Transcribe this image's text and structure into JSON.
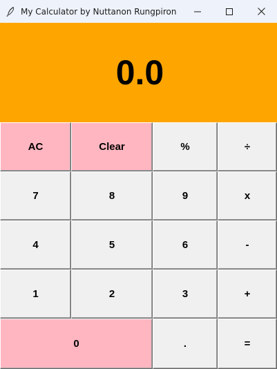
{
  "window": {
    "title": "My Calculator by Nuttanon Rungpiron",
    "minimize_glyph": "—",
    "maximize_glyph": "☐",
    "close_glyph": "✕"
  },
  "display": {
    "value": "0.0",
    "background": "#ffa500"
  },
  "colors": {
    "accent_buttons": "#ffb6c1",
    "default_buttons": "#f0f0f0"
  },
  "buttons": {
    "ac": "AC",
    "clear": "Clear",
    "percent": "%",
    "divide": "÷",
    "seven": "7",
    "eight": "8",
    "nine": "9",
    "multiply": "x",
    "four": "4",
    "five": "5",
    "six": "6",
    "minus": "-",
    "one": "1",
    "two": "2",
    "three": "3",
    "plus": "+",
    "zero": "0",
    "dot": ".",
    "equals": "="
  }
}
